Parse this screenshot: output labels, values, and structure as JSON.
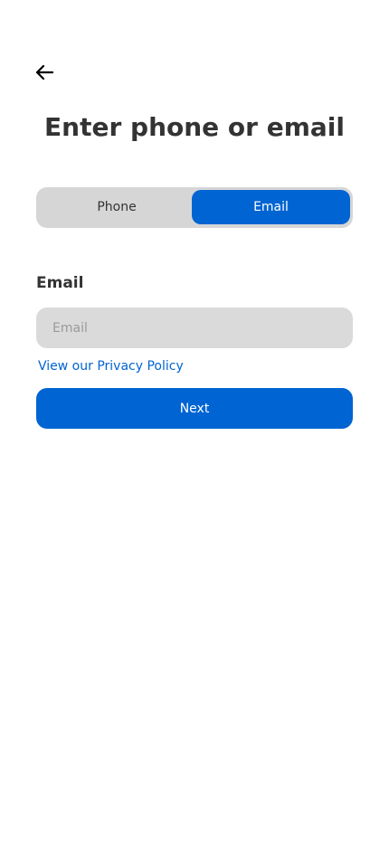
{
  "header": {
    "back_icon": "arrow-left-icon",
    "title": "Enter phone or email"
  },
  "segmented_control": {
    "options": [
      {
        "label": "Phone",
        "selected": false
      },
      {
        "label": "Email",
        "selected": true
      }
    ]
  },
  "email_field": {
    "label": "Email",
    "placeholder": "Email",
    "value": ""
  },
  "links": {
    "privacy": "View our Privacy Policy"
  },
  "actions": {
    "next_label": "Next"
  },
  "colors": {
    "accent": "#0064d2",
    "segmented_track": "#d6d6d6",
    "input_bg": "#dadada",
    "text": "#333333"
  }
}
